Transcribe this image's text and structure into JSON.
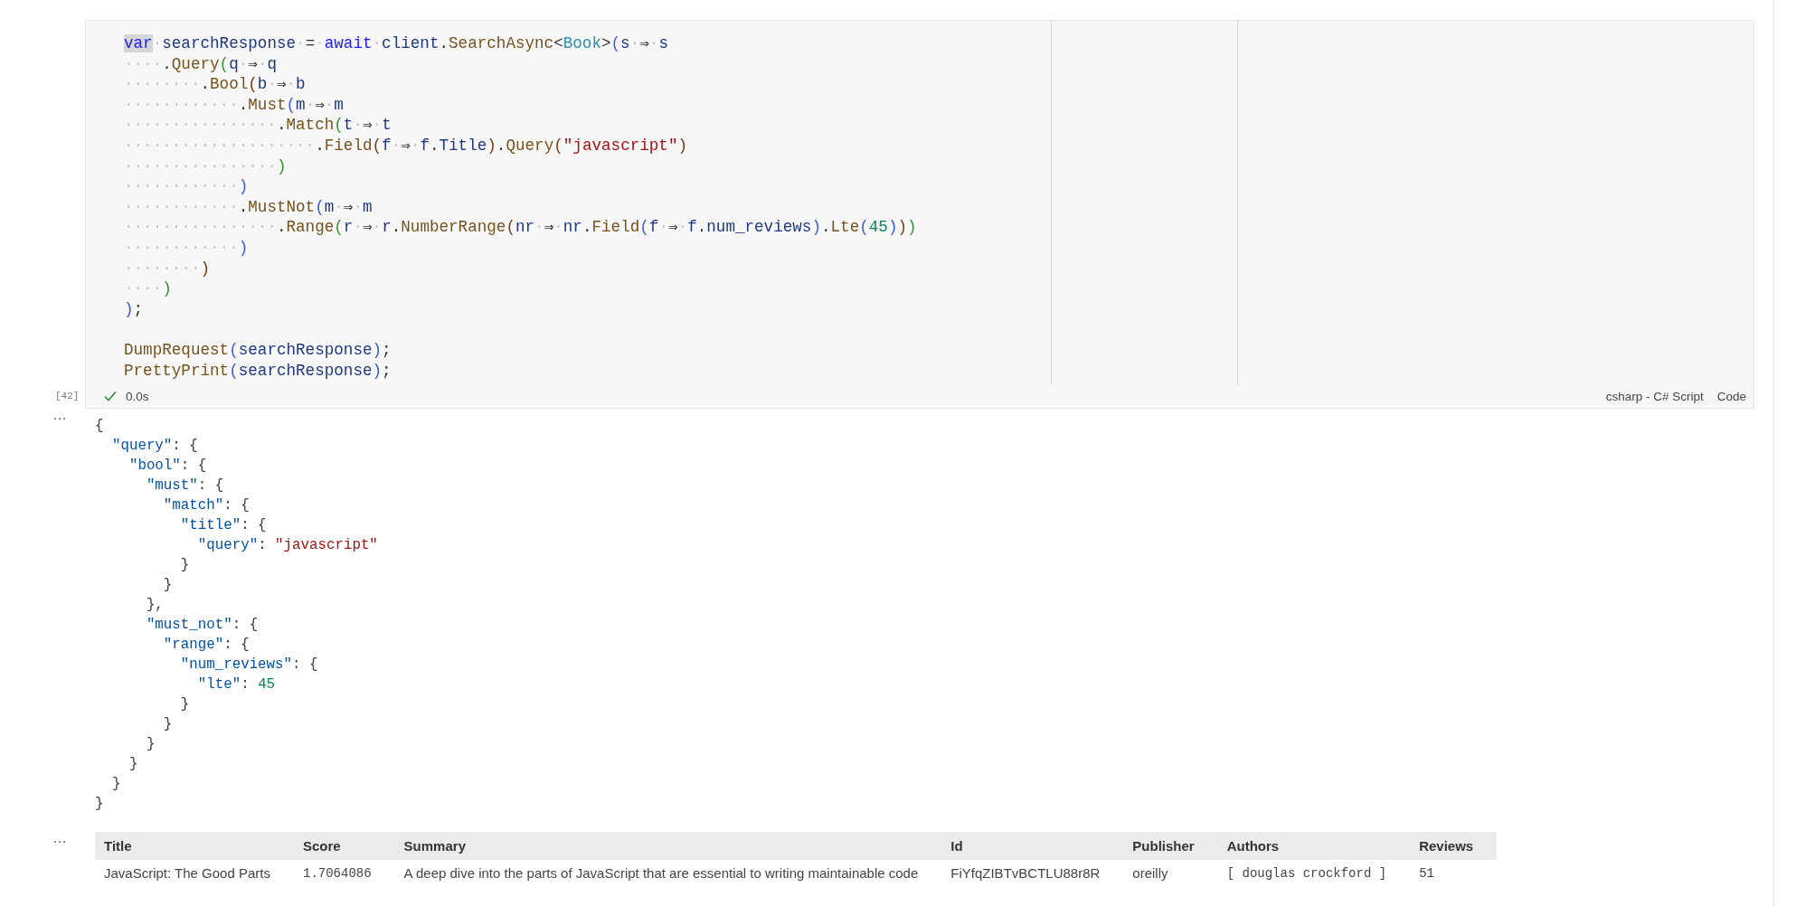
{
  "code_cell": {
    "lines": [
      {
        "tokens": [
          {
            "kind": "kw_hl",
            "text": "var"
          },
          {
            "kind": "ws",
            "text": "·"
          },
          {
            "kind": "id",
            "text": "searchResponse"
          },
          {
            "kind": "ws",
            "text": "·"
          },
          {
            "kind": "op",
            "text": "="
          },
          {
            "kind": "ws",
            "text": "·"
          },
          {
            "kind": "kw",
            "text": "await"
          },
          {
            "kind": "ws",
            "text": "·"
          },
          {
            "kind": "id",
            "text": "client"
          },
          {
            "kind": "op",
            "text": "."
          },
          {
            "kind": "method",
            "text": "SearchAsync"
          },
          {
            "kind": "op",
            "text": "<"
          },
          {
            "kind": "type",
            "text": "Book"
          },
          {
            "kind": "op",
            "text": ">"
          },
          {
            "kind": "p1",
            "text": "("
          },
          {
            "kind": "id",
            "text": "s"
          },
          {
            "kind": "ws",
            "text": "·"
          },
          {
            "kind": "op",
            "text": "⇒"
          },
          {
            "kind": "ws",
            "text": "·"
          },
          {
            "kind": "id",
            "text": "s"
          }
        ]
      },
      {
        "tokens": [
          {
            "kind": "ws",
            "text": "····"
          },
          {
            "kind": "op",
            "text": "."
          },
          {
            "kind": "method",
            "text": "Query"
          },
          {
            "kind": "p2",
            "text": "("
          },
          {
            "kind": "id",
            "text": "q"
          },
          {
            "kind": "ws",
            "text": "·"
          },
          {
            "kind": "op",
            "text": "⇒"
          },
          {
            "kind": "ws",
            "text": "·"
          },
          {
            "kind": "id",
            "text": "q"
          }
        ]
      },
      {
        "tokens": [
          {
            "kind": "ws",
            "text": "········"
          },
          {
            "kind": "op",
            "text": "."
          },
          {
            "kind": "method",
            "text": "Bool"
          },
          {
            "kind": "p3",
            "text": "("
          },
          {
            "kind": "id",
            "text": "b"
          },
          {
            "kind": "ws",
            "text": "·"
          },
          {
            "kind": "op",
            "text": "⇒"
          },
          {
            "kind": "ws",
            "text": "·"
          },
          {
            "kind": "id",
            "text": "b"
          }
        ]
      },
      {
        "tokens": [
          {
            "kind": "ws",
            "text": "············"
          },
          {
            "kind": "op",
            "text": "."
          },
          {
            "kind": "method",
            "text": "Must"
          },
          {
            "kind": "p1",
            "text": "("
          },
          {
            "kind": "id",
            "text": "m"
          },
          {
            "kind": "ws",
            "text": "·"
          },
          {
            "kind": "op",
            "text": "⇒"
          },
          {
            "kind": "ws",
            "text": "·"
          },
          {
            "kind": "id",
            "text": "m"
          }
        ]
      },
      {
        "tokens": [
          {
            "kind": "ws",
            "text": "················"
          },
          {
            "kind": "op",
            "text": "."
          },
          {
            "kind": "method",
            "text": "Match"
          },
          {
            "kind": "p2",
            "text": "("
          },
          {
            "kind": "id",
            "text": "t"
          },
          {
            "kind": "ws",
            "text": "·"
          },
          {
            "kind": "op",
            "text": "⇒"
          },
          {
            "kind": "ws",
            "text": "·"
          },
          {
            "kind": "id",
            "text": "t"
          }
        ]
      },
      {
        "tokens": [
          {
            "kind": "ws",
            "text": "····················"
          },
          {
            "kind": "op",
            "text": "."
          },
          {
            "kind": "method",
            "text": "Field"
          },
          {
            "kind": "p3",
            "text": "("
          },
          {
            "kind": "id",
            "text": "f"
          },
          {
            "kind": "ws",
            "text": "·"
          },
          {
            "kind": "op",
            "text": "⇒"
          },
          {
            "kind": "ws",
            "text": "·"
          },
          {
            "kind": "id",
            "text": "f"
          },
          {
            "kind": "op",
            "text": "."
          },
          {
            "kind": "id",
            "text": "Title"
          },
          {
            "kind": "p3",
            "text": ")"
          },
          {
            "kind": "op",
            "text": "."
          },
          {
            "kind": "method",
            "text": "Query"
          },
          {
            "kind": "p3",
            "text": "("
          },
          {
            "kind": "str",
            "text": "\"javascript\""
          },
          {
            "kind": "p3",
            "text": ")"
          }
        ]
      },
      {
        "tokens": [
          {
            "kind": "ws",
            "text": "················"
          },
          {
            "kind": "p2",
            "text": ")"
          }
        ]
      },
      {
        "tokens": [
          {
            "kind": "ws",
            "text": "············"
          },
          {
            "kind": "p1",
            "text": ")"
          }
        ]
      },
      {
        "tokens": [
          {
            "kind": "ws",
            "text": "············"
          },
          {
            "kind": "op",
            "text": "."
          },
          {
            "kind": "method",
            "text": "MustNot"
          },
          {
            "kind": "p1",
            "text": "("
          },
          {
            "kind": "id",
            "text": "m"
          },
          {
            "kind": "ws",
            "text": "·"
          },
          {
            "kind": "op",
            "text": "⇒"
          },
          {
            "kind": "ws",
            "text": "·"
          },
          {
            "kind": "id",
            "text": "m"
          }
        ]
      },
      {
        "tokens": [
          {
            "kind": "ws",
            "text": "················"
          },
          {
            "kind": "op",
            "text": "."
          },
          {
            "kind": "method",
            "text": "Range"
          },
          {
            "kind": "p2",
            "text": "("
          },
          {
            "kind": "id",
            "text": "r"
          },
          {
            "kind": "ws",
            "text": "·"
          },
          {
            "kind": "op",
            "text": "⇒"
          },
          {
            "kind": "ws",
            "text": "·"
          },
          {
            "kind": "id",
            "text": "r"
          },
          {
            "kind": "op",
            "text": "."
          },
          {
            "kind": "method",
            "text": "NumberRange"
          },
          {
            "kind": "p3",
            "text": "("
          },
          {
            "kind": "id",
            "text": "nr"
          },
          {
            "kind": "ws",
            "text": "·"
          },
          {
            "kind": "op",
            "text": "⇒"
          },
          {
            "kind": "ws",
            "text": "·"
          },
          {
            "kind": "id",
            "text": "nr"
          },
          {
            "kind": "op",
            "text": "."
          },
          {
            "kind": "method",
            "text": "Field"
          },
          {
            "kind": "p1",
            "text": "("
          },
          {
            "kind": "id",
            "text": "f"
          },
          {
            "kind": "ws",
            "text": "·"
          },
          {
            "kind": "op",
            "text": "⇒"
          },
          {
            "kind": "ws",
            "text": "·"
          },
          {
            "kind": "id",
            "text": "f"
          },
          {
            "kind": "op",
            "text": "."
          },
          {
            "kind": "id",
            "text": "num_reviews"
          },
          {
            "kind": "p1",
            "text": ")"
          },
          {
            "kind": "op",
            "text": "."
          },
          {
            "kind": "method",
            "text": "Lte"
          },
          {
            "kind": "p1",
            "text": "("
          },
          {
            "kind": "num",
            "text": "45"
          },
          {
            "kind": "p1",
            "text": ")"
          },
          {
            "kind": "p3",
            "text": ")"
          },
          {
            "kind": "p2",
            "text": ")"
          }
        ]
      },
      {
        "tokens": [
          {
            "kind": "ws",
            "text": "············"
          },
          {
            "kind": "p1",
            "text": ")"
          }
        ]
      },
      {
        "tokens": [
          {
            "kind": "ws",
            "text": "········"
          },
          {
            "kind": "p3",
            "text": ")"
          }
        ]
      },
      {
        "tokens": [
          {
            "kind": "ws",
            "text": "····"
          },
          {
            "kind": "p2",
            "text": ")"
          }
        ]
      },
      {
        "tokens": [
          {
            "kind": "p1",
            "text": ")"
          },
          {
            "kind": "op",
            "text": ";"
          }
        ]
      },
      {
        "tokens": [
          {
            "kind": "method",
            "text": "DumpRequest"
          },
          {
            "kind": "p1",
            "text": "("
          },
          {
            "kind": "id",
            "text": "searchResponse"
          },
          {
            "kind": "p1",
            "text": ")"
          },
          {
            "kind": "op",
            "text": ";"
          }
        ]
      },
      {
        "tokens": [
          {
            "kind": "method",
            "text": "PrettyPrint"
          },
          {
            "kind": "p1",
            "text": "("
          },
          {
            "kind": "id",
            "text": "searchResponse"
          },
          {
            "kind": "p1",
            "text": ")"
          },
          {
            "kind": "op",
            "text": ";"
          }
        ]
      }
    ],
    "execution_count": "[42]",
    "succeeded": true,
    "duration": "0.0s",
    "language": "csharp - C# Script",
    "cell_type": "Code"
  },
  "outputs": [
    {
      "kind": "json",
      "more": "…",
      "lines": [
        [
          {
            "kind": "punct",
            "text": "{"
          }
        ],
        [
          {
            "kind": "key",
            "text": "  \"query\""
          },
          {
            "kind": "punct",
            "text": ": {"
          }
        ],
        [
          {
            "kind": "key",
            "text": "    \"bool\""
          },
          {
            "kind": "punct",
            "text": ": {"
          }
        ],
        [
          {
            "kind": "key",
            "text": "      \"must\""
          },
          {
            "kind": "punct",
            "text": ": {"
          }
        ],
        [
          {
            "kind": "key",
            "text": "        \"match\""
          },
          {
            "kind": "punct",
            "text": ": {"
          }
        ],
        [
          {
            "kind": "key",
            "text": "          \"title\""
          },
          {
            "kind": "punct",
            "text": ": {"
          }
        ],
        [
          {
            "kind": "key",
            "text": "            \"query\""
          },
          {
            "kind": "punct",
            "text": ": "
          },
          {
            "kind": "str",
            "text": "\"javascript\""
          }
        ],
        [
          {
            "kind": "punct",
            "text": "          }"
          }
        ],
        [
          {
            "kind": "punct",
            "text": "        }"
          }
        ],
        [
          {
            "kind": "punct",
            "text": "      },"
          }
        ],
        [
          {
            "kind": "key",
            "text": "      \"must_not\""
          },
          {
            "kind": "punct",
            "text": ": {"
          }
        ],
        [
          {
            "kind": "key",
            "text": "        \"range\""
          },
          {
            "kind": "punct",
            "text": ": {"
          }
        ],
        [
          {
            "kind": "key",
            "text": "          \"num_reviews\""
          },
          {
            "kind": "punct",
            "text": ": {"
          }
        ],
        [
          {
            "kind": "key",
            "text": "            \"lte\""
          },
          {
            "kind": "punct",
            "text": ": "
          },
          {
            "kind": "num",
            "text": "45"
          }
        ],
        [
          {
            "kind": "punct",
            "text": "          }"
          }
        ],
        [
          {
            "kind": "punct",
            "text": "        }"
          }
        ],
        [
          {
            "kind": "punct",
            "text": "      }"
          }
        ],
        [
          {
            "kind": "punct",
            "text": "    }"
          }
        ],
        [
          {
            "kind": "punct",
            "text": "  }"
          }
        ],
        [
          {
            "kind": "punct",
            "text": "}"
          }
        ]
      ]
    },
    {
      "kind": "table",
      "more": "…",
      "columns": [
        {
          "label": "Title",
          "kind": "text"
        },
        {
          "label": "Score",
          "kind": "mono"
        },
        {
          "label": "Summary",
          "kind": "text"
        },
        {
          "label": "Id",
          "kind": "text"
        },
        {
          "label": "Publisher",
          "kind": "text"
        },
        {
          "label": "Authors",
          "kind": "mono"
        },
        {
          "label": "Reviews",
          "kind": "mono"
        }
      ],
      "rows": [
        [
          "JavaScript: The Good Parts",
          "1.7064086",
          "A deep dive into the parts of JavaScript that are essential to writing maintainable code",
          "FiYfqZIBTvBCTLU88r8R",
          "oreilly",
          "[ douglas crockford ]",
          "51"
        ]
      ]
    }
  ]
}
